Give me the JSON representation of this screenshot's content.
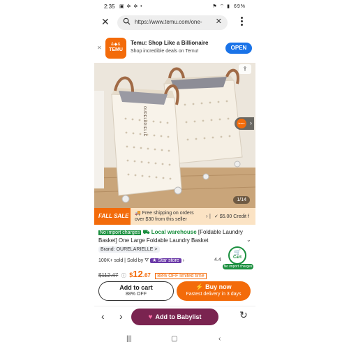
{
  "status": {
    "time": "2:35",
    "left_icons": "▣ ✲ ✲ •",
    "right_icons": "⚑ ⌔ ▮",
    "battery": "69%"
  },
  "browser": {
    "url": "https://www.temu.com/one-",
    "clear_label": "✕",
    "close_label": "✕"
  },
  "banner": {
    "dismiss_label": "✕",
    "logo_top": "&◆&",
    "logo_text": "TEMU",
    "title": "Temu: Shop Like a Billionaire",
    "subtitle": "Shop incredible deals on Temu!",
    "open_label": "OPEN"
  },
  "hero": {
    "counter": "1/14",
    "share_icon": "share-icon",
    "badge_text": "temu",
    "brand_print": "OURELARIELLE"
  },
  "sale": {
    "tag": "FALL SALE",
    "shipping_line1": "Free shipping on orders",
    "shipping_line2": "over $30 from this seller",
    "credit": "$5.00 Credit f"
  },
  "product": {
    "no_import": "No import charges",
    "local": "Local warehouse",
    "title": "[Foldable Laundry Basket] One Large Foldable Laundry Basket",
    "brand": "Brand: OURELARIELLE >",
    "sold": "100K+ sold",
    "sold_by": "Sold by",
    "star_store": "Star store",
    "rating": "4.4",
    "old_price": "$112.47",
    "price_dollar": "$",
    "price_big": "12",
    "price_cents": ".67",
    "off_badge": "88% OFF limited time"
  },
  "cart_bubble": {
    "label": "Cart",
    "note": "No import charges"
  },
  "actions": {
    "add_to_cart": "Add to cart",
    "add_to_cart_sub": "88% OFF",
    "buy_now": "Buy now",
    "buy_now_sub": "Fastest delivery in 3 days"
  },
  "bottom": {
    "back": "‹",
    "forward": "›",
    "babylist": "Add to Babylist",
    "reload": "↻"
  },
  "nav": {
    "recents": "|||",
    "home": "▢",
    "back": "‹"
  },
  "colors": {
    "accent": "#f36b0a",
    "green": "#1a8f3e",
    "blue": "#1a73e8",
    "babylist": "#7a2450"
  }
}
